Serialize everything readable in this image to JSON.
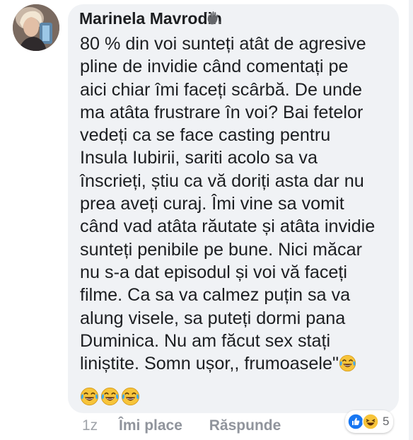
{
  "comment": {
    "author": "Marinela Mavrodin",
    "lines": [
      "80 % din voi sunteți atât de agresive",
      "pline de invidie când comentați pe",
      "aici chiar îmi faceți scârbă. De unde",
      "ma atâta frustrare în voi? Bai fetelor",
      "vedeți ca se face casting pentru",
      "Insula Iubirii, sariti acolo sa va",
      "înscrieți, știu ca vă doriți asta dar nu",
      "prea aveți curaj. Îmi vine sa vomit",
      "când vad atâta răutate și atâta invidie",
      "sunteți penibile pe bune. Nici măcar",
      "nu s-a dat episodul și voi vă faceți",
      "filme. Ca sa va calmez puțin sa va",
      "alung visele, sa puteți dormi pana",
      "Duminica. Nu am făcut sex stați",
      "liniștite. Somn ușor,, frumoasele\""
    ],
    "trailing_emoji": "tears-of-joy-emoji",
    "emoji_row": [
      "tears-of-joy-emoji",
      "tears-of-joy-emoji",
      "tears-of-joy-emoji"
    ]
  },
  "actions": {
    "time": "1z",
    "like": "Îmi place",
    "reply": "Răspunde"
  },
  "reactions": {
    "icons": [
      "like-reaction-icon",
      "haha-reaction-icon"
    ],
    "count": "5"
  },
  "colors": {
    "bubble": "#f0f2f5",
    "text": "#1c1e21",
    "muted": "#90949c",
    "like_blue": "#1877f2",
    "emoji_yellow": "#f7c43a"
  },
  "icons": {
    "author_badge": "waving-hand-icon"
  }
}
